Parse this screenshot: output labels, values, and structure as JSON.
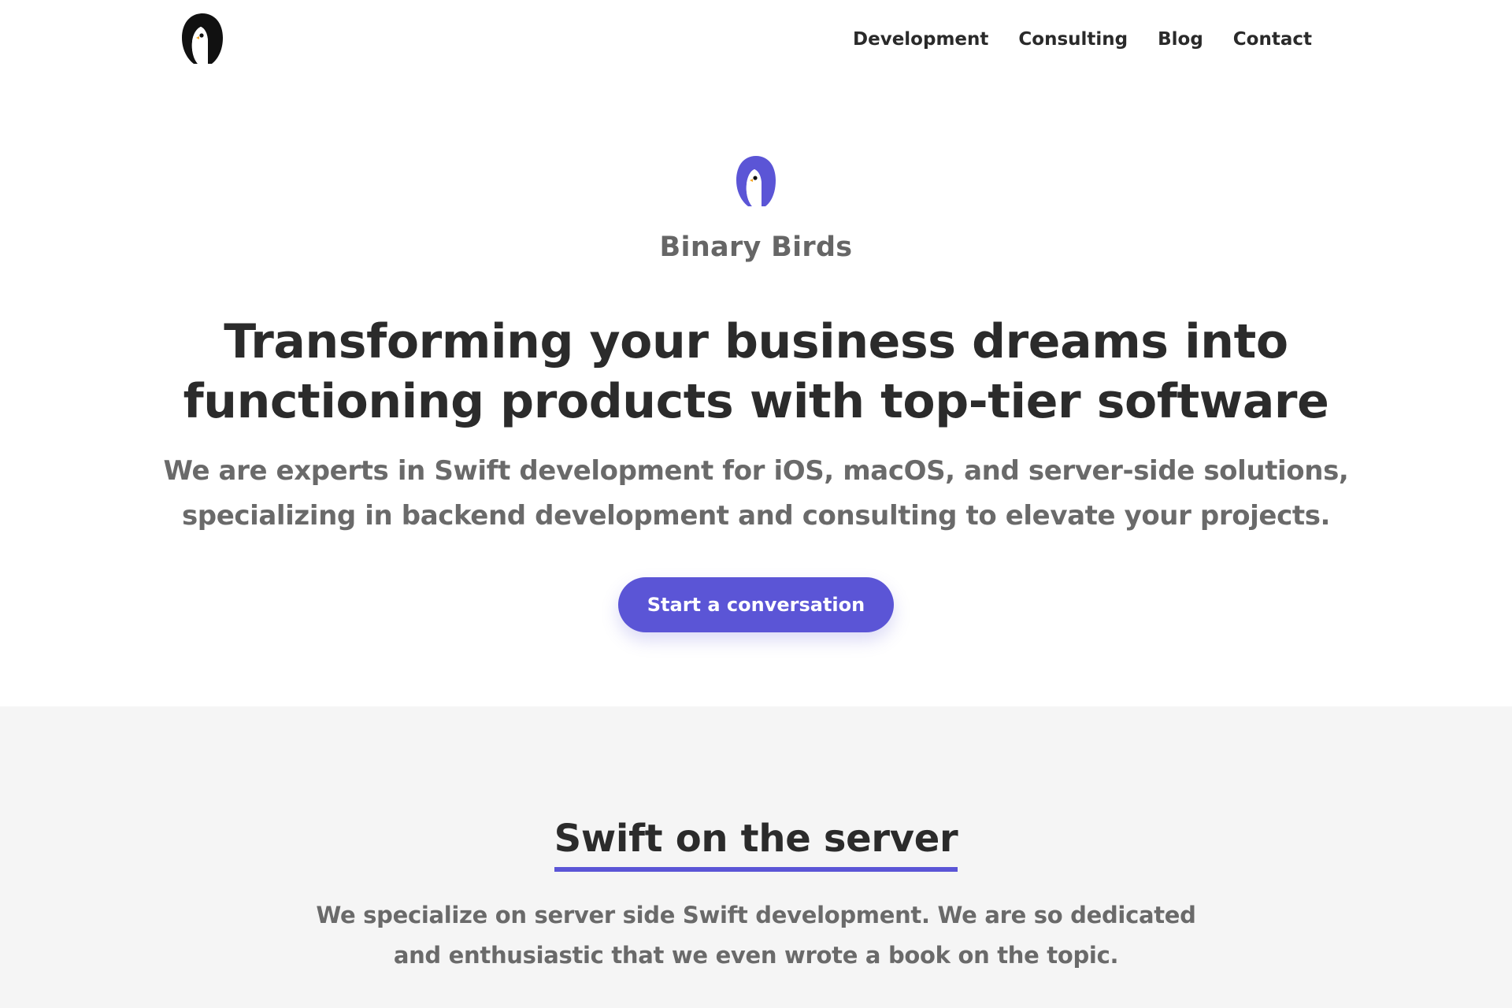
{
  "nav": {
    "logo_alt": "Binary Birds logo",
    "items": [
      {
        "label": "Development"
      },
      {
        "label": "Consulting"
      },
      {
        "label": "Blog"
      },
      {
        "label": "Contact"
      }
    ]
  },
  "hero": {
    "brand_name": "Binary Birds",
    "title": "Transforming your business dreams into functioning products with top-tier software",
    "subtitle": "We are experts in Swift development for iOS, macOS, and server-side solutions, specializing in backend development and consulting to elevate your projects.",
    "cta_label": "Start a conversation"
  },
  "section": {
    "title": "Swift on the server",
    "text": "We specialize on server side Swift development. We are so dedicated and enthusiastic that we even wrote a book on the topic."
  },
  "colors": {
    "accent": "#5b55d6",
    "text_dark": "#2b2b2b",
    "text_muted": "#6a6a6a",
    "section_bg": "#f5f5f5",
    "bird_beak": "#f5a623"
  }
}
